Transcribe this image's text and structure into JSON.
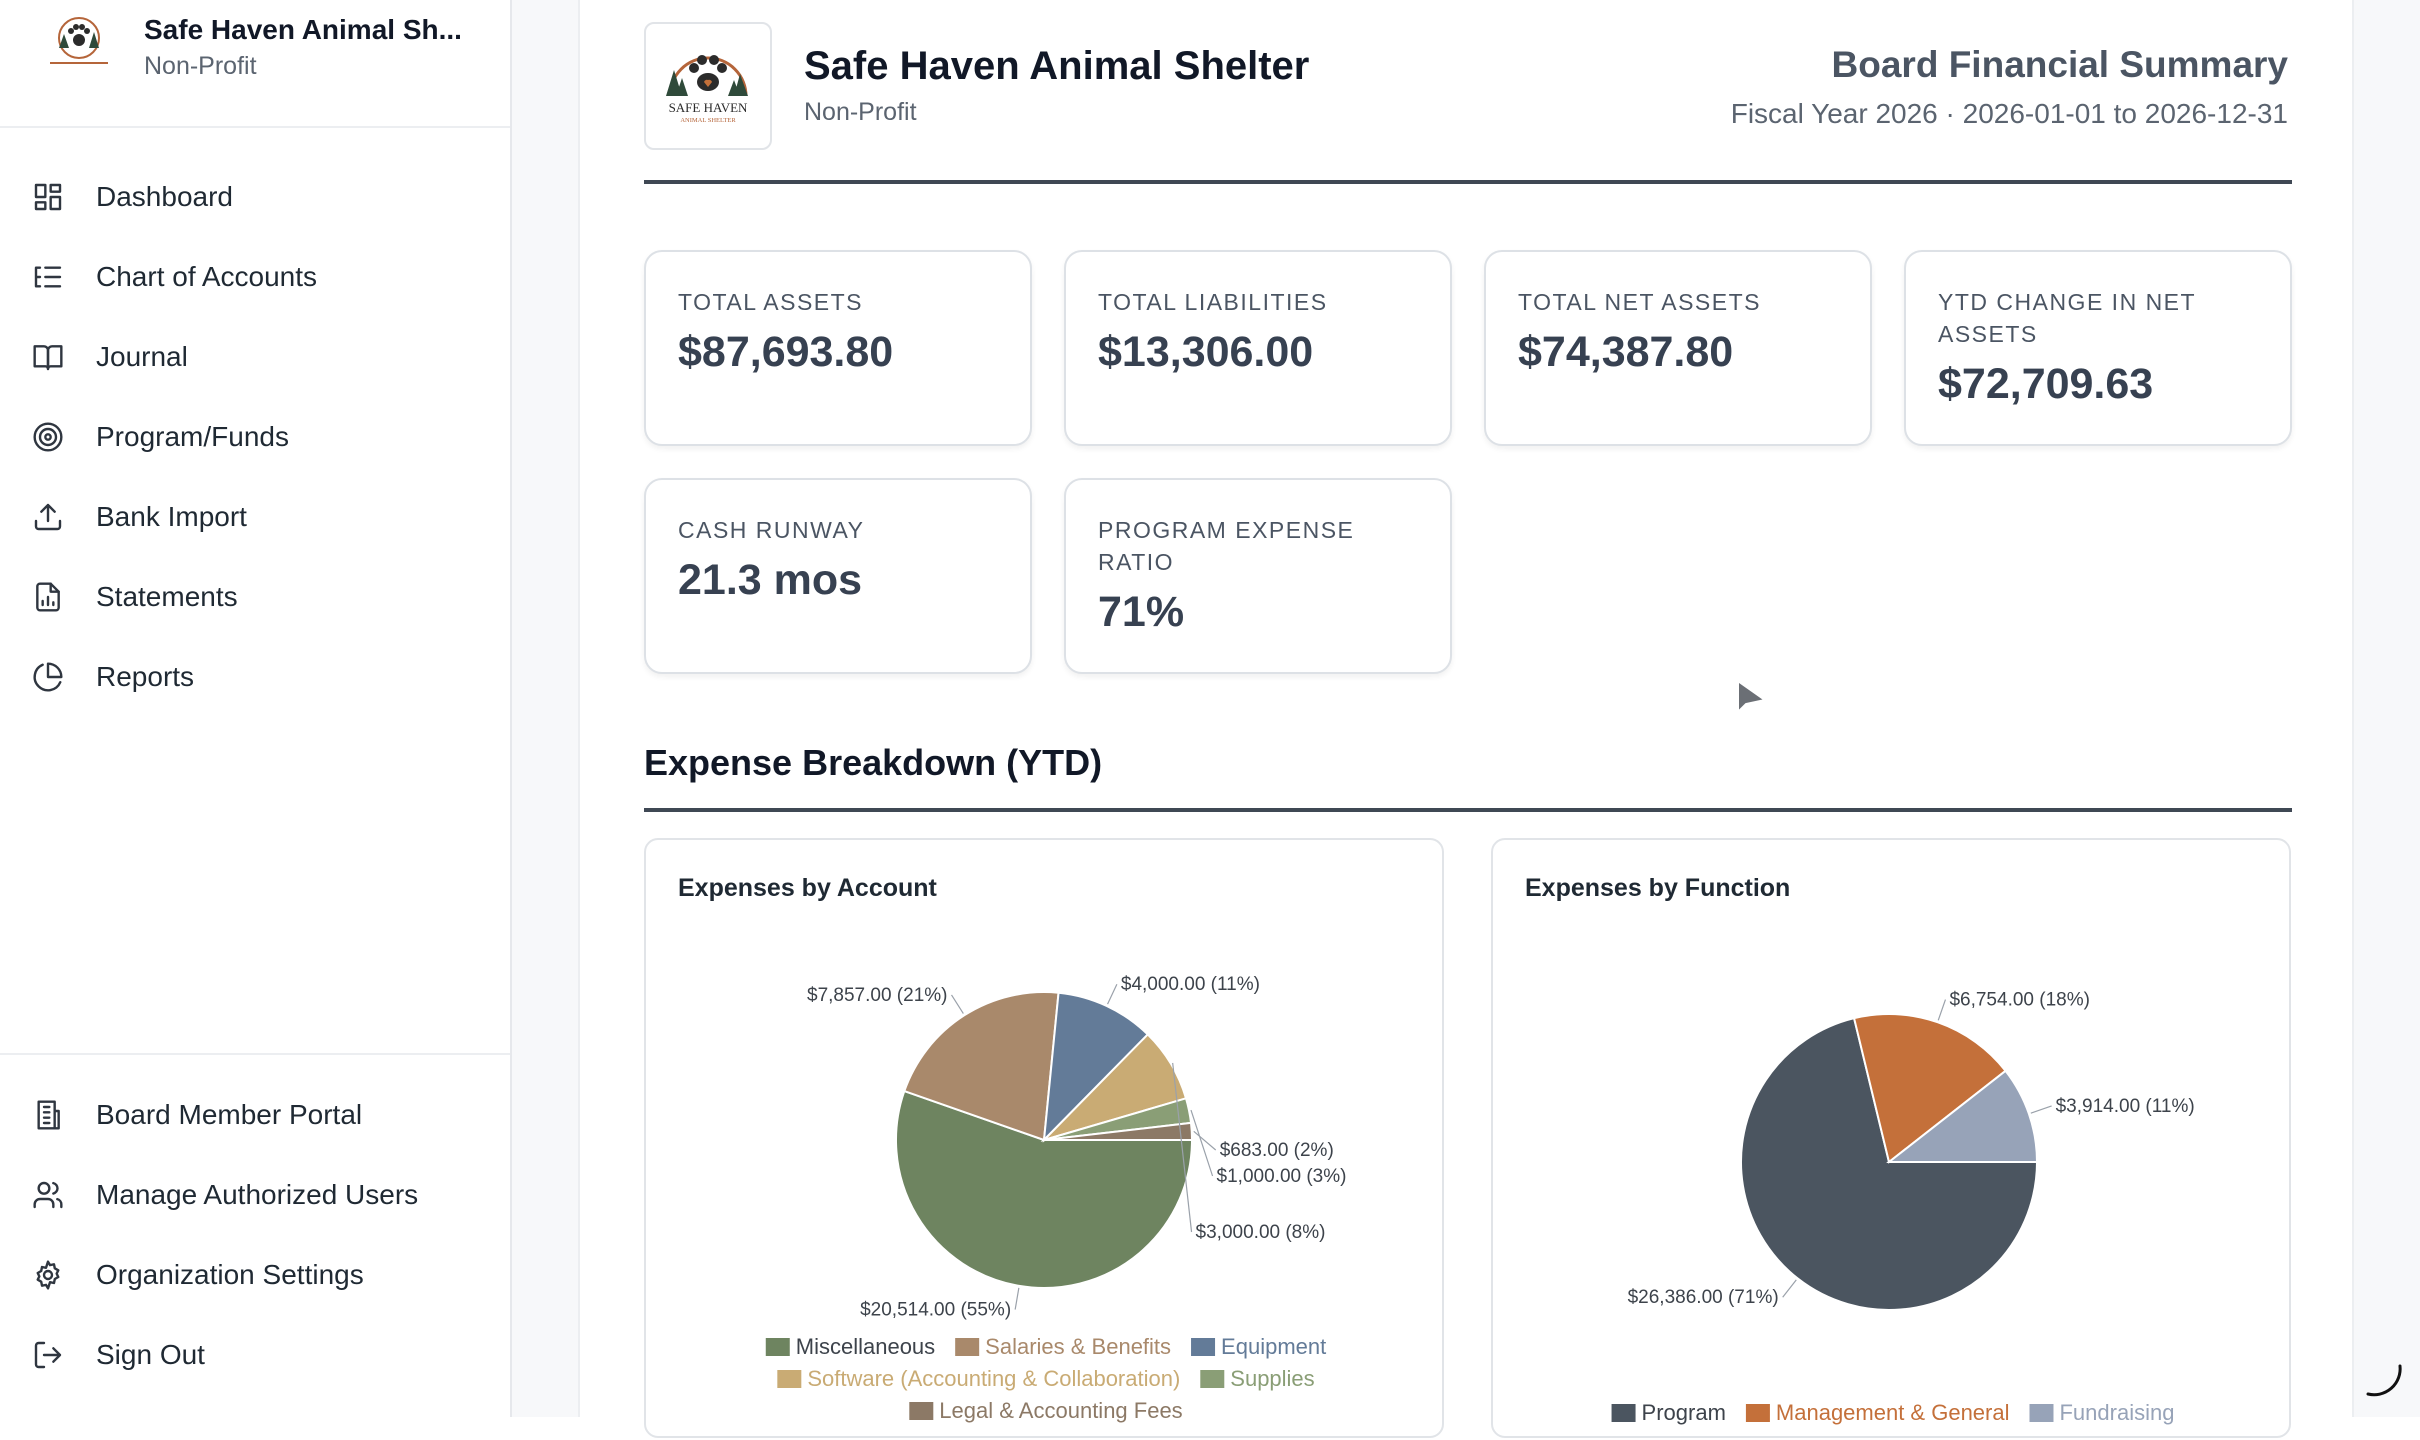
{
  "sidebar": {
    "org_name": "Safe Haven Animal Sh...",
    "org_type": "Non-Profit",
    "nav": [
      {
        "label": "Dashboard",
        "icon": "dashboard-icon"
      },
      {
        "label": "Chart of Accounts",
        "icon": "list-tree-icon"
      },
      {
        "label": "Journal",
        "icon": "book-open-icon"
      },
      {
        "label": "Program/Funds",
        "icon": "target-icon"
      },
      {
        "label": "Bank Import",
        "icon": "upload-icon"
      },
      {
        "label": "Statements",
        "icon": "file-chart-icon"
      },
      {
        "label": "Reports",
        "icon": "pie-chart-icon"
      }
    ],
    "bottom_nav": [
      {
        "label": "Board Member Portal",
        "icon": "building-icon"
      },
      {
        "label": "Manage Authorized Users",
        "icon": "users-icon"
      },
      {
        "label": "Organization Settings",
        "icon": "gear-icon"
      },
      {
        "label": "Sign Out",
        "icon": "sign-out-icon"
      }
    ]
  },
  "header": {
    "org_name": "Safe Haven Animal Shelter",
    "org_type": "Non-Profit",
    "report_title": "Board Financial Summary",
    "report_subtitle": "Fiscal Year 2026 · 2026-01-01 to 2026-12-31",
    "logo_text": "SAFE HAVEN",
    "logo_subtext": "ANIMAL SHELTER"
  },
  "kpis": [
    {
      "label": "TOTAL ASSETS",
      "value": "$87,693.80"
    },
    {
      "label": "TOTAL LIABILITIES",
      "value": "$13,306.00"
    },
    {
      "label": "TOTAL NET ASSETS",
      "value": "$74,387.80"
    },
    {
      "label": "YTD CHANGE IN NET ASSETS",
      "value": "$72,709.63"
    },
    {
      "label": "CASH RUNWAY",
      "value": "21.3 mos"
    },
    {
      "label": "PROGRAM EXPENSE RATIO",
      "value": "71%"
    }
  ],
  "section": {
    "title": "Expense Breakdown (YTD)"
  },
  "colors": {
    "miscellaneous": "#6e8460",
    "salaries": "#a9896b",
    "equipment": "#637b98",
    "software": "#c9ab74",
    "supplies": "#8a9e76",
    "legal": "#8c7966",
    "program": "#4b5560",
    "management": "#c4703a",
    "fundraising": "#97a3b8"
  },
  "chart_data": [
    {
      "type": "pie",
      "title": "Expenses by Account",
      "slices": [
        {
          "name": "Miscellaneous",
          "value": 20514.0,
          "label": "$20,514.00 (55%)",
          "color": "#6e8460"
        },
        {
          "name": "Salaries & Benefits",
          "value": 7857.0,
          "label": "$7,857.00 (21%)",
          "color": "#a9896b"
        },
        {
          "name": "Equipment",
          "value": 4000.0,
          "label": "$4,000.00 (11%)",
          "color": "#637b98"
        },
        {
          "name": "Software (Accounting & Collaboration)",
          "value": 3000.0,
          "label": "$3,000.00 (8%)",
          "color": "#c9ab74"
        },
        {
          "name": "Supplies",
          "value": 1000.0,
          "label": "$1,000.00 (3%)",
          "color": "#8a9e76"
        },
        {
          "name": "Legal & Accounting Fees",
          "value": 683.0,
          "label": "$683.00 (2%)",
          "color": "#8c7966"
        }
      ]
    },
    {
      "type": "pie",
      "title": "Expenses by Function",
      "slices": [
        {
          "name": "Program",
          "value": 26386.0,
          "label": "$26,386.00 (71%)",
          "color": "#4b5560"
        },
        {
          "name": "Management & General",
          "value": 6754.0,
          "label": "$6,754.00 (18%)",
          "color": "#c4703a"
        },
        {
          "name": "Fundraising",
          "value": 3914.0,
          "label": "$3,914.00 (11%)",
          "color": "#97a3b8"
        }
      ]
    }
  ]
}
